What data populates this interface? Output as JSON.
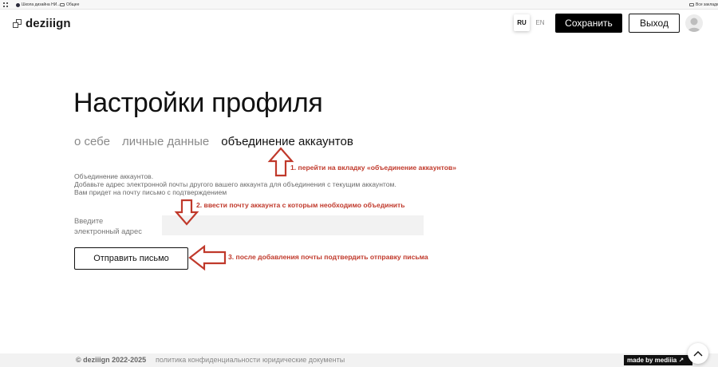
{
  "bookmarks": {
    "items": [
      {
        "label": "Школа дизайна НИ...",
        "icon": "favicon-icon"
      },
      {
        "label": "Общее",
        "icon": "folder-icon"
      }
    ],
    "all_label": "Все закладки"
  },
  "header": {
    "logo_text": "deziiign",
    "languages": [
      "RU",
      "EN"
    ],
    "active_language": "RU",
    "save_label": "Сохранить",
    "exit_label": "Выход"
  },
  "main": {
    "title": "Настройки профиля",
    "tabs": [
      {
        "label": "о себе",
        "active": false
      },
      {
        "label": "личные данные",
        "active": false
      },
      {
        "label": "объединение аккаунтов",
        "active": true
      }
    ],
    "description": [
      "Объединение аккаунтов.",
      "Добавьте адрес электронной почты другого вашего аккаунта для объединения с текущим аккаунтом.",
      "Вам придет на почту письмо с подтверждением"
    ],
    "email_field": {
      "label_line1": "Введите",
      "label_line2": "электронный адрес",
      "value": ""
    },
    "send_label": "Отправить письмо"
  },
  "annotations": [
    "1. перейти на вкладку «объединение аккаунтов»",
    "2. ввести почту аккаунта с которым необходимо объединить",
    "3. после добавления почты подтвердить отправку письма"
  ],
  "footer": {
    "copyright": "© deziiign 2022-2025",
    "privacy_link": "политика конфиденциальности",
    "legal_link": "юридические документы",
    "made_by": "made by mediiia ↗"
  },
  "colors": {
    "accent": "#000000",
    "annotation": "#c0392b",
    "input_bg": "#f2f2f2",
    "footer_bg": "#f2f2f2"
  }
}
